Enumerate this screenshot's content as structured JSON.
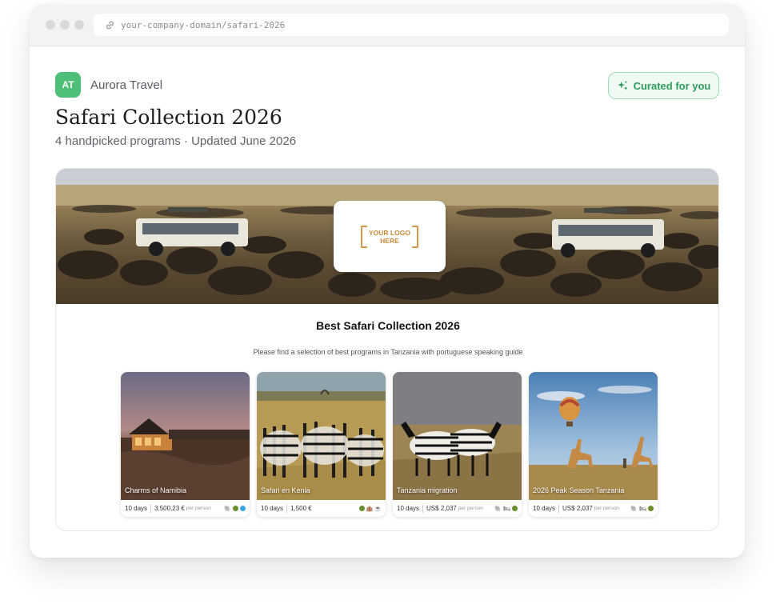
{
  "browser": {
    "url": "your-company-domain/safari-2026"
  },
  "header": {
    "avatar_initials": "AT",
    "brand_name": "Aurora Travel",
    "curated_label": "Curated for you",
    "title": "Safari Collection 2026",
    "subtitle": "4 handpicked programs · Updated June 2026"
  },
  "hero": {
    "logo_placeholder_line1": "YOUR LOGO",
    "logo_placeholder_line2": "HERE"
  },
  "collection": {
    "title": "Best Safari Collection 2026",
    "description": "Please find a selection of best programs in Tanzania with portuguese speaking guide"
  },
  "programs": [
    {
      "name": "Charms of Namibia",
      "duration": "10 days",
      "price": "3,500,23 €",
      "per_person": "per person",
      "icons": [
        "elephant-icon",
        "globe-icon",
        "diamond-icon"
      ]
    },
    {
      "name": "Safari en Kenia",
      "duration": "10 days",
      "price": "1,500 €",
      "per_person": "",
      "icons": [
        "globe-icon",
        "hotel-icon",
        "coffee-icon"
      ]
    },
    {
      "name": "Tanzania migration",
      "duration": "10 days",
      "price": "US$ 2,037",
      "per_person": "per person",
      "icons": [
        "elephant-icon",
        "bed-icon",
        "globe-icon"
      ]
    },
    {
      "name": "2026 Peak Season Tanzania",
      "duration": "10 days",
      "price": "US$ 2,037",
      "per_person": "per person",
      "icons": [
        "elephant-icon",
        "bed-icon",
        "globe-icon"
      ]
    }
  ],
  "colors": {
    "accent_green": "#4dbf78",
    "curated_text": "#2e9c5c",
    "logo_orange": "#d59a4c"
  }
}
